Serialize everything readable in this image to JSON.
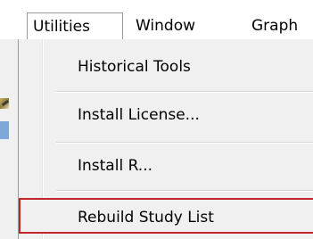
{
  "menubar": {
    "items": [
      {
        "label": "Utilities",
        "active": true
      },
      {
        "label": "Window",
        "active": false
      },
      {
        "label": "Graph",
        "active": false
      }
    ]
  },
  "dropdown": {
    "items": [
      {
        "label": "Historical Tools"
      },
      {
        "label": "Install License..."
      },
      {
        "label": "Install R..."
      },
      {
        "label": "Rebuild Study List",
        "highlighted": true
      }
    ]
  },
  "colors": {
    "highlight_border": "#c0262c",
    "menu_background": "#f0f0f0",
    "menubar_background": "#ffffff"
  }
}
